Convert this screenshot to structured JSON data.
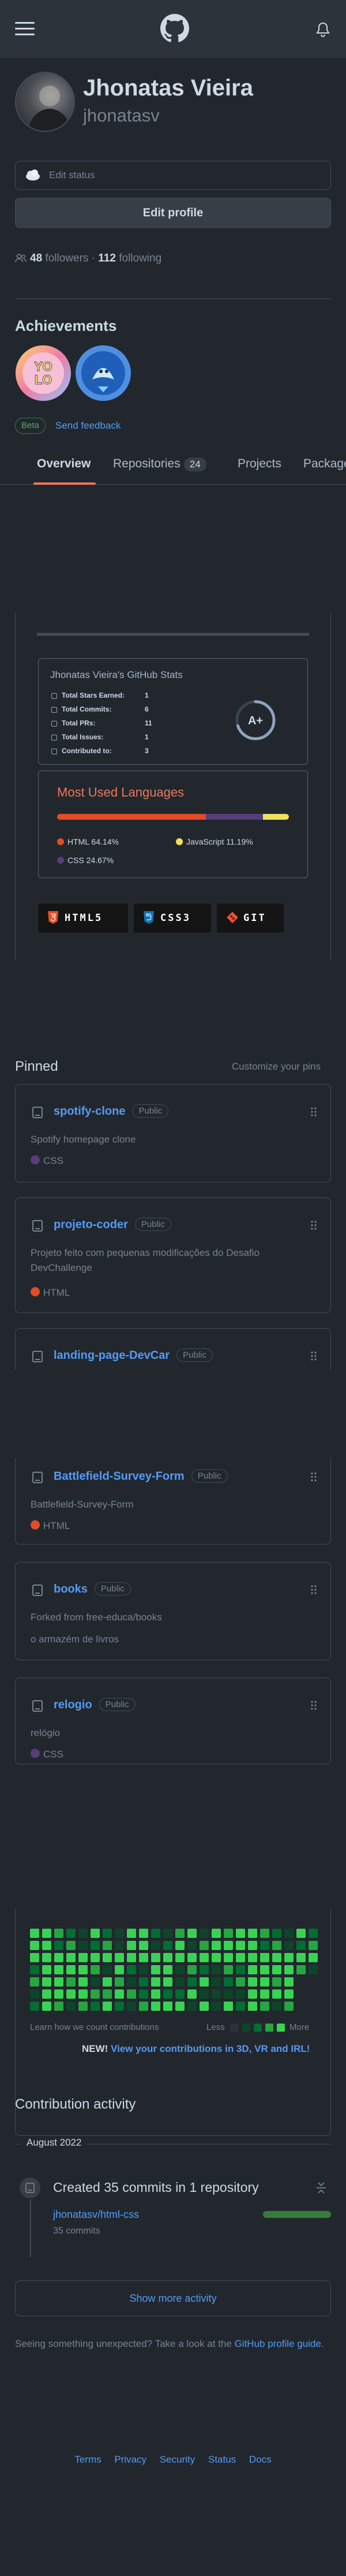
{
  "profile": {
    "name": "Jhonatas Vieira",
    "login": "jhonatasv",
    "edit_status": "Edit status",
    "edit_profile": "Edit profile",
    "followers_count": "48",
    "followers_label": "followers",
    "separator": "·",
    "following_count": "112",
    "following_label": "following"
  },
  "achievements": {
    "title": "Achievements",
    "beta": "Beta",
    "feedback": "Send feedback",
    "badges": [
      "yolo-badge-icon",
      "pull-shark-badge-icon"
    ]
  },
  "tabs": [
    {
      "label": "Overview",
      "active": true
    },
    {
      "label": "Repositories",
      "count": "24"
    },
    {
      "label": "Projects"
    },
    {
      "label": "Packages"
    }
  ],
  "stats": {
    "title": "Jhonatas Vieira's GitHub Stats",
    "rows": [
      {
        "label": "Total Stars Earned:",
        "value": "1"
      },
      {
        "label": "Total Commits:",
        "value": "6"
      },
      {
        "label": "Total PRs:",
        "value": "11"
      },
      {
        "label": "Total Issues:",
        "value": "1"
      },
      {
        "label": "Contributed to:",
        "value": "3"
      }
    ],
    "grade": "A+",
    "grade_fraction": 0.7
  },
  "languages": {
    "title": "Most Used Languages",
    "items": [
      {
        "name": "HTML",
        "percent": "64.14%",
        "value": 64.14,
        "color": "#e34c26"
      },
      {
        "name": "JavaScript",
        "percent": "11.19%",
        "value": 11.19,
        "color": "#f1e05a"
      },
      {
        "name": "CSS",
        "percent": "24.67%",
        "value": 24.67,
        "color": "#563d7c"
      }
    ]
  },
  "shields": [
    {
      "label": "HTML5",
      "color": "#e34f26"
    },
    {
      "label": "CSS3",
      "color": "#1572b6"
    },
    {
      "label": "GIT",
      "color": "#f05033"
    }
  ],
  "pinned": {
    "title": "Pinned",
    "customize": "Customize your pins",
    "badge": "Public",
    "repos": [
      {
        "name": "spotify-clone",
        "desc": "Spotify homepage clone",
        "lang": "CSS",
        "lang_color": "#563d7c"
      },
      {
        "name": "projeto-coder",
        "desc": "Projeto feito com pequenas modificações do Desafio DevChallenge",
        "lang": "HTML",
        "lang_color": "#e34c26"
      },
      {
        "name": "landing-page-DevCar",
        "desc": "",
        "lang": ""
      },
      {
        "name": "Battlefield-Survey-Form",
        "desc": "Battlefield-Survey-Form",
        "lang": "HTML",
        "lang_color": "#e34c26"
      },
      {
        "name": "books",
        "desc": "Forked from free-educa/books",
        "desc2": "o armazém de livros",
        "lang": ""
      },
      {
        "name": "relogio",
        "desc": "relógio",
        "lang": "CSS",
        "lang_color": "#563d7c"
      }
    ]
  },
  "contributions": {
    "learn": "Learn how we count contributions",
    "less": "Less",
    "more": "More",
    "new_label": "NEW!",
    "new_link": "View your contributions in 3D, VR and IRL!"
  },
  "activity": {
    "title": "Contribution activity",
    "month": "August 2022",
    "created": "Created 35 commits in 1 repository",
    "repo": "jhonatasv/html-css",
    "commits": "35 commits",
    "show_more": "Show more activity",
    "unexpected_text": "Seeing something unexpected? Take a look at the ",
    "guide_link": "GitHub profile guide",
    "unexpected_end": "."
  },
  "footer": {
    "links": [
      "Terms",
      "Privacy",
      "Security",
      "Status",
      "Docs"
    ]
  }
}
